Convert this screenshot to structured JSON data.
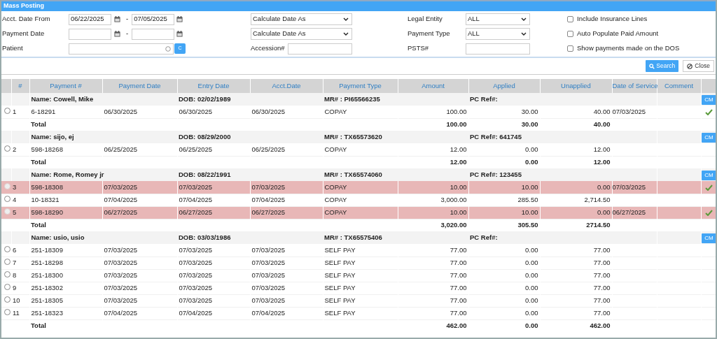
{
  "title": "Mass Posting",
  "acct_date": {
    "label": "Acct. Date From",
    "from": "06/22/2025",
    "separator": "-",
    "to": "07/05/2025",
    "calc": "Calculate Date As"
  },
  "payment_date": {
    "label": "Payment Date",
    "separator": "-",
    "calc": "Calculate Date As"
  },
  "patient": {
    "label": "Patient",
    "clear_button": "C"
  },
  "accession": {
    "label": "Accession#"
  },
  "legal_entity": {
    "label": "Legal Entity",
    "value": "ALL"
  },
  "payment_type": {
    "label": "Payment Type",
    "value": "ALL"
  },
  "psts": {
    "label": "PSTS#"
  },
  "options": [
    {
      "label": "Include Insurance Lines",
      "checked": false
    },
    {
      "label": "Auto Populate Paid Amount",
      "checked": false
    },
    {
      "label": "Show payments made on the DOS",
      "checked": false
    }
  ],
  "actions": {
    "search": "Search",
    "close": "Close"
  },
  "table": {
    "columns": [
      "#",
      "Payment #",
      "Payment Date",
      "Entry Date",
      "Acct.Date",
      "Payment Type",
      "Amount",
      "Applied",
      "Unapplied",
      "Date of Service",
      "Comment"
    ],
    "groups": [
      {
        "name": "Name: Cowell, Mike",
        "dob": "DOB: 02/02/1989",
        "mr": "MR# : PI65566235",
        "pc_ref": "PC Ref#:",
        "cm": "CM",
        "payments": [
          {
            "number": "1",
            "selected": false,
            "highlighted": false,
            "posted": true,
            "payment_no": "6-18291",
            "payment_date": "06/30/2025",
            "entry_date": "06/30/2025",
            "acct_date": "06/30/2025",
            "type": "COPAY",
            "amount": "100.00",
            "applied": "30.00",
            "unapplied": "40.00",
            "dos": "07/03/2025"
          }
        ],
        "total": {
          "label": "Total",
          "amount": "100.00",
          "applied": "30.00",
          "unapplied": "40.00"
        }
      },
      {
        "name": "Name: sijo, ej",
        "dob": "DOB: 08/29/2000",
        "mr": "MR# : TX65573620",
        "pc_ref": "PC Ref#: 641745",
        "cm": "CM",
        "payments": [
          {
            "number": "2",
            "selected": false,
            "highlighted": false,
            "posted": false,
            "payment_no": "598-18268",
            "payment_date": "06/25/2025",
            "entry_date": "06/25/2025",
            "acct_date": "06/25/2025",
            "type": "COPAY",
            "amount": "12.00",
            "applied": "0.00",
            "unapplied": "12.00"
          }
        ],
        "total": {
          "label": "Total",
          "amount": "12.00",
          "applied": "0.00",
          "unapplied": "12.00"
        }
      },
      {
        "name": "Name: Rome, Romey jr",
        "dob": "DOB: 08/22/1991",
        "mr": "MR# : TX65574060",
        "pc_ref": "PC Ref#: 123455",
        "cm": "CM",
        "payments": [
          {
            "number": "3",
            "selected": false,
            "highlighted": true,
            "posted": true,
            "payment_no": "598-18308",
            "payment_date": "07/03/2025",
            "entry_date": "07/03/2025",
            "acct_date": "07/03/2025",
            "type": "COPAY",
            "amount": "10.00",
            "applied": "10.00",
            "unapplied": "0.00",
            "dos": "07/03/2025"
          },
          {
            "number": "4",
            "selected": false,
            "highlighted": false,
            "posted": false,
            "payment_no": "10-18321",
            "payment_date": "07/04/2025",
            "entry_date": "07/04/2025",
            "acct_date": "07/04/2025",
            "type": "COPAY",
            "amount": "3,000.00",
            "applied": "285.50",
            "unapplied": "2,714.50"
          },
          {
            "number": "5",
            "selected": false,
            "highlighted": true,
            "posted": true,
            "payment_no": "598-18290",
            "payment_date": "06/27/2025",
            "entry_date": "06/27/2025",
            "acct_date": "06/27/2025",
            "type": "COPAY",
            "amount": "10.00",
            "applied": "10.00",
            "unapplied": "0.00",
            "dos": "06/27/2025"
          }
        ],
        "total": {
          "label": "Total",
          "amount": "3,020.00",
          "applied": "305.50",
          "unapplied": "2714.50"
        }
      },
      {
        "name": "Name: usio, usio",
        "dob": "DOB: 03/03/1986",
        "mr": "MR# : TX65575406",
        "pc_ref": "PC Ref#:",
        "cm": "CM",
        "payments": [
          {
            "number": "6",
            "selected": false,
            "highlighted": false,
            "posted": false,
            "payment_no": "251-18309",
            "payment_date": "07/03/2025",
            "entry_date": "07/03/2025",
            "acct_date": "07/03/2025",
            "type": "SELF PAY",
            "amount": "77.00",
            "applied": "0.00",
            "unapplied": "77.00"
          },
          {
            "number": "7",
            "selected": false,
            "highlighted": false,
            "posted": false,
            "payment_no": "251-18298",
            "payment_date": "07/03/2025",
            "entry_date": "07/03/2025",
            "acct_date": "07/03/2025",
            "type": "SELF PAY",
            "amount": "77.00",
            "applied": "0.00",
            "unapplied": "77.00"
          },
          {
            "number": "8",
            "selected": false,
            "highlighted": false,
            "posted": false,
            "payment_no": "251-18300",
            "payment_date": "07/03/2025",
            "entry_date": "07/03/2025",
            "acct_date": "07/03/2025",
            "type": "SELF PAY",
            "amount": "77.00",
            "applied": "0.00",
            "unapplied": "77.00"
          },
          {
            "number": "9",
            "selected": false,
            "highlighted": false,
            "posted": false,
            "payment_no": "251-18302",
            "payment_date": "07/03/2025",
            "entry_date": "07/03/2025",
            "acct_date": "07/03/2025",
            "type": "SELF PAY",
            "amount": "77.00",
            "applied": "0.00",
            "unapplied": "77.00"
          },
          {
            "number": "10",
            "selected": false,
            "highlighted": false,
            "posted": false,
            "payment_no": "251-18305",
            "payment_date": "07/03/2025",
            "entry_date": "07/03/2025",
            "acct_date": "07/03/2025",
            "type": "SELF PAY",
            "amount": "77.00",
            "applied": "0.00",
            "unapplied": "77.00"
          },
          {
            "number": "11",
            "selected": false,
            "highlighted": false,
            "posted": false,
            "payment_no": "251-18323",
            "payment_date": "07/04/2025",
            "entry_date": "07/04/2025",
            "acct_date": "07/04/2025",
            "type": "SELF PAY",
            "amount": "77.00",
            "applied": "0.00",
            "unapplied": "77.00"
          }
        ],
        "total": {
          "label": "Total",
          "amount": "462.00",
          "applied": "0.00",
          "unapplied": "462.00"
        }
      }
    ]
  }
}
